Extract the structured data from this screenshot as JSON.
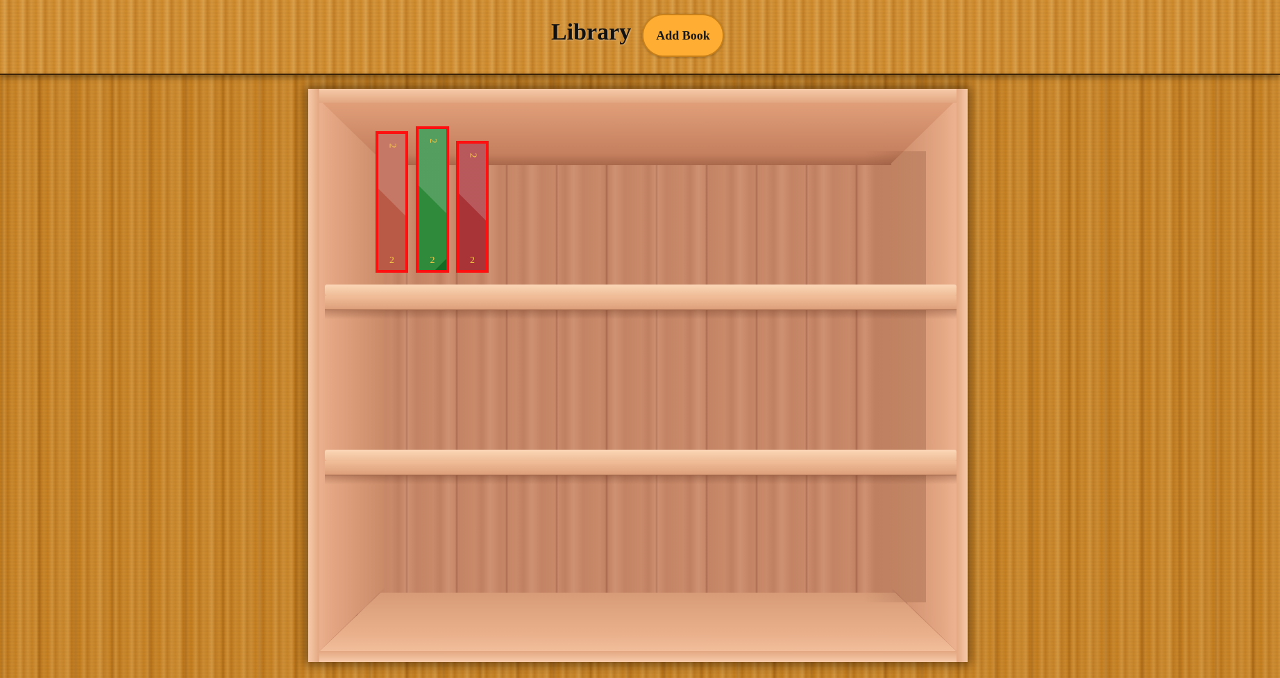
{
  "header": {
    "title": "Library",
    "add_book_label": "Add Book"
  },
  "colors": {
    "header_bg": "#d08a2b",
    "button_bg": "#ffad33",
    "book_border": "#ff1010",
    "spine_text": "#f5c84a"
  },
  "shelf": {
    "books": [
      {
        "top_label": "2",
        "bottom_label": "2",
        "color": "#b95a46"
      },
      {
        "top_label": "2",
        "bottom_label": "2",
        "color": "#2f8a3c"
      },
      {
        "top_label": "2",
        "bottom_label": "2",
        "color": "#a83438"
      }
    ]
  }
}
